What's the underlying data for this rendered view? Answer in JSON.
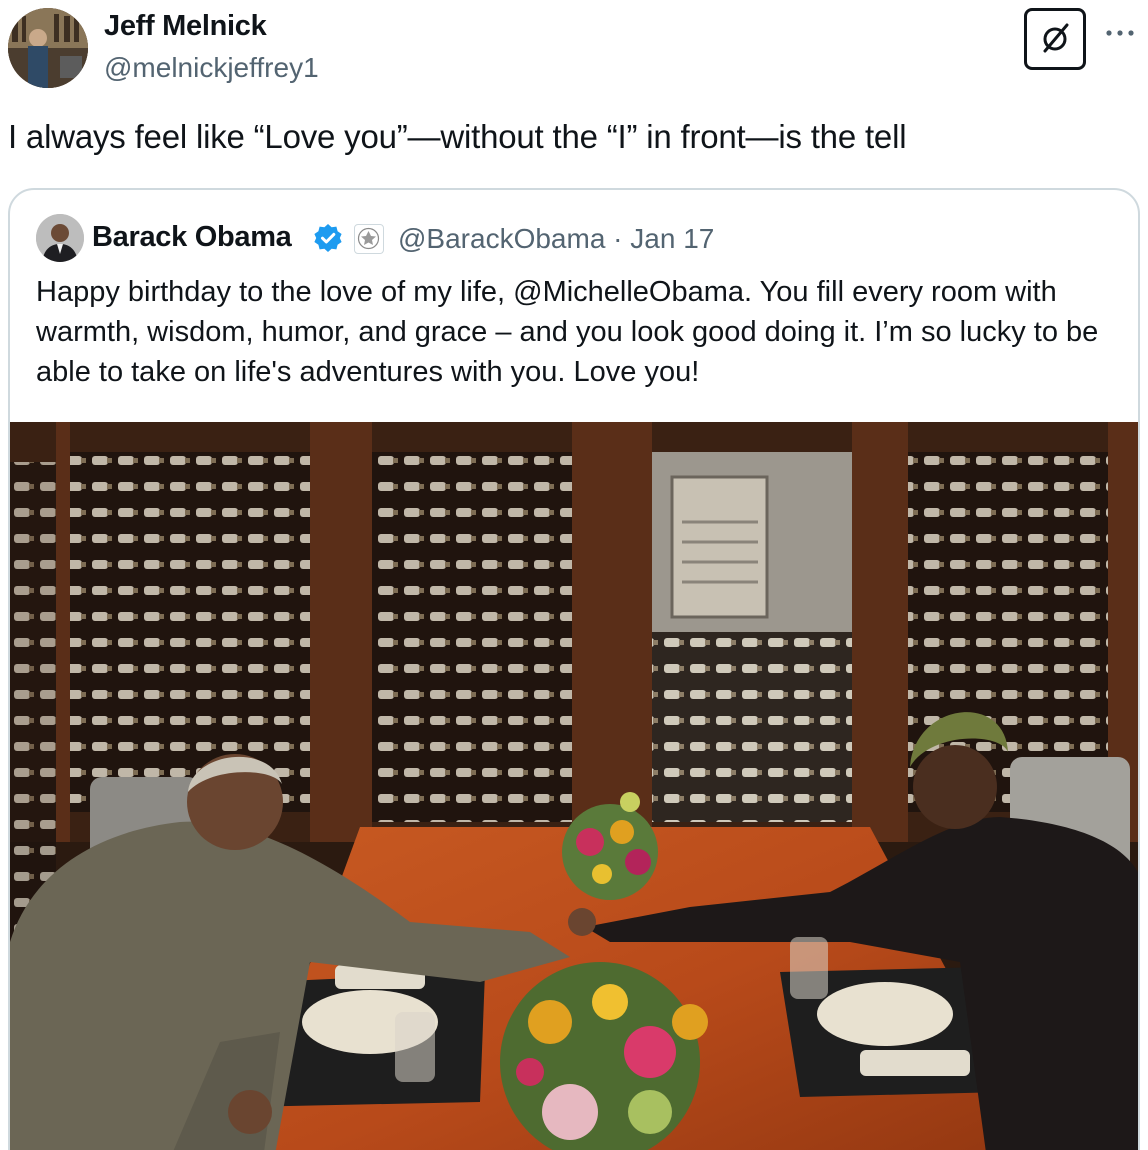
{
  "author": {
    "name": "Jeff Melnick",
    "handle": "@melnickjeffrey1",
    "avatar_icon": "bookshelf-portrait"
  },
  "actions": {
    "grok_icon": "slashed-circle-icon",
    "more_label": "···"
  },
  "tweet": {
    "text": "I always feel like “Love you”—without the “I” in front—is the tell"
  },
  "quoted": {
    "name": "Barack Obama",
    "verified_icon": "verified-badge-icon",
    "affiliate_icon": "presidential-seal-icon",
    "handle": "@BarackObama",
    "separator": "·",
    "date": "Jan 17",
    "text": "Happy birthday to the love of my life, @MichelleObama. You fill every room with warmth, wisdom, humor, and grace – and you look good doing it. I’m so lucky to be able to take on life's adventures with you. Love you!",
    "photo_icon": "dinner-photo-image"
  },
  "colors": {
    "text_primary": "#0f1419",
    "text_secondary": "#536471",
    "border": "#cfd9de",
    "verified_blue": "#1d9bf0"
  }
}
